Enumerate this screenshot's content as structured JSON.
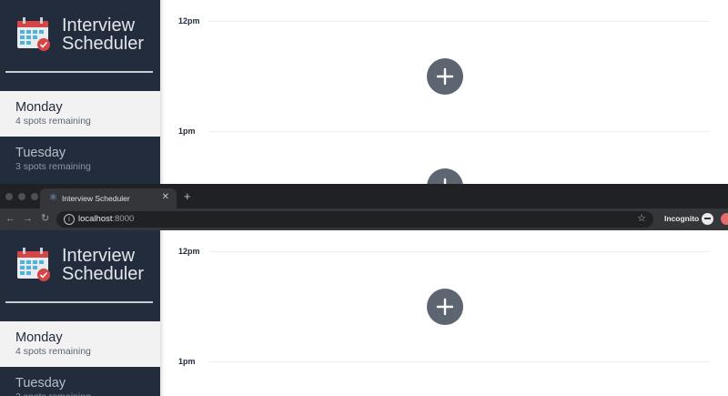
{
  "app": {
    "brand_line1": "Interview",
    "brand_line2": "Scheduler",
    "days": [
      {
        "name": "Monday",
        "spots": "4 spots remaining"
      },
      {
        "name": "Tuesday",
        "spots": "3 spots remaining"
      }
    ],
    "times": [
      "12pm",
      "1pm"
    ]
  },
  "browser": {
    "tab_title": "Interview Scheduler",
    "url_host": "localhost",
    "url_port": ":8000",
    "mode_label": "Incognito"
  },
  "icons": {
    "logo": "calendar-check-icon",
    "add": "plus-icon",
    "favicon": "react-icon",
    "back": "arrow-left-icon",
    "forward": "arrow-right-icon",
    "reload": "reload-icon",
    "info": "info-icon",
    "bookmark": "star-icon",
    "incognito": "incognito-icon"
  },
  "colors": {
    "sidebar": "#222c3d",
    "selected_day": "#f2f2f2",
    "add_button": "#5d6570",
    "chrome": "#35363a"
  }
}
